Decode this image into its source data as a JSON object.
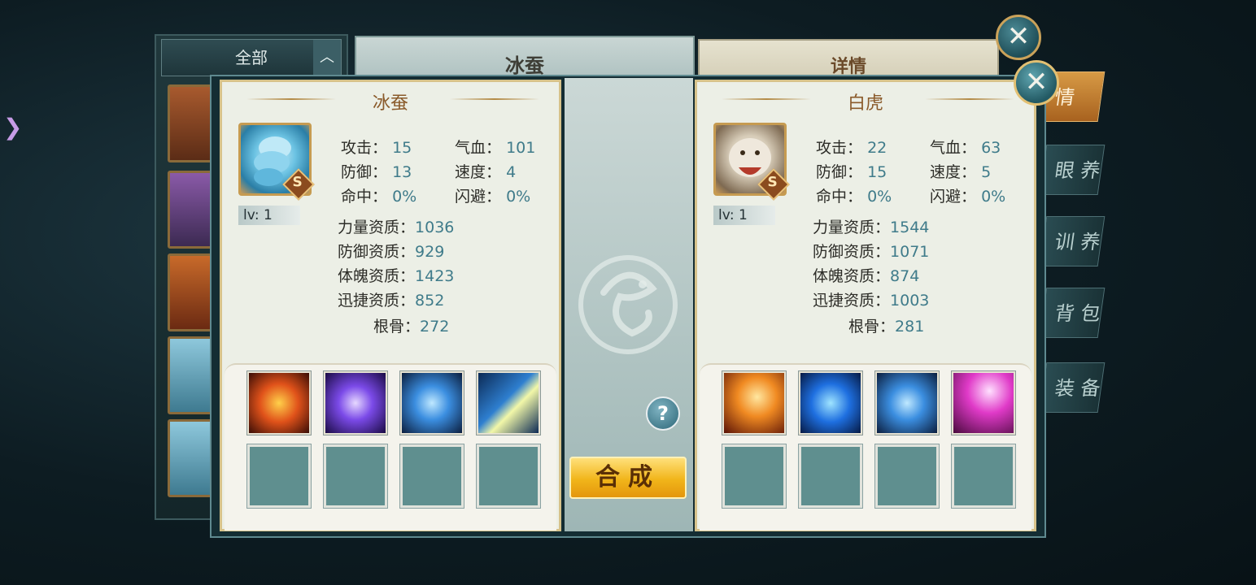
{
  "background": {
    "list_header": "全部",
    "title": "冰蚕",
    "detail_header": "详情",
    "side_tabs": [
      "情",
      "眼 养",
      "训 养",
      "背 包",
      "装 备"
    ]
  },
  "left_pet": {
    "name": "冰蚕",
    "rank": "S",
    "level": "lv: 1",
    "attack_label": "攻击：",
    "attack": "15",
    "hp_label": "气血：",
    "hp": "101",
    "defense_label": "防御：",
    "defense": "13",
    "speed_label": "速度：",
    "speed": "4",
    "hit_label": "命中：",
    "hit": "0%",
    "dodge_label": "闪避：",
    "dodge": "0%",
    "str_apt_label": "力量资质：",
    "str_apt": "1036",
    "def_apt_label": "防御资质：",
    "def_apt": "929",
    "con_apt_label": "体魄资质：",
    "con_apt": "1423",
    "agi_apt_label": "迅捷资质：",
    "agi_apt": "852",
    "root_label": "根骨：",
    "root": "272",
    "skills": [
      "fire-swirl-skill",
      "purple-vortex-skill",
      "water-heart-skill",
      "moon-lightning-skill"
    ]
  },
  "right_pet": {
    "name": "白虎",
    "rank": "S",
    "level": "lv: 1",
    "attack_label": "攻击：",
    "attack": "22",
    "hp_label": "气血：",
    "hp": "63",
    "defense_label": "防御：",
    "defense": "15",
    "speed_label": "速度：",
    "speed": "5",
    "hit_label": "命中：",
    "hit": "0%",
    "dodge_label": "闪避：",
    "dodge": "0%",
    "str_apt_label": "力量资质：",
    "str_apt": "1544",
    "def_apt_label": "防御资质：",
    "def_apt": "1071",
    "con_apt_label": "体魄资质：",
    "con_apt": "874",
    "agi_apt_label": "迅捷资质：",
    "agi_apt": "1003",
    "root_label": "根骨：",
    "root": "281",
    "skills": [
      "phoenix-fire-skill",
      "blue-beast-skill",
      "water-heart-skill",
      "pink-lightning-skill"
    ]
  },
  "buttons": {
    "combine": "合成",
    "help": "?",
    "close": "✕"
  },
  "colors": {
    "panel_bg": "#ecefe6",
    "stat_value": "#3f7b8a",
    "name_color": "#8a5a2a",
    "combine_gold": "#f1b51a"
  }
}
